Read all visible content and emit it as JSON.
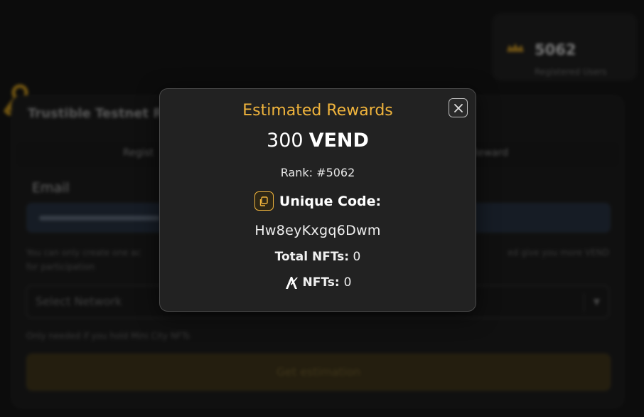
{
  "background": {
    "stats": {
      "value": "5062",
      "label": "Registered Users"
    },
    "panel_title": "Trustible Testnet R",
    "tabs": [
      "Regist",
      "Reward"
    ],
    "email_label": "Email",
    "email_hint_left": "You can only create one ac",
    "email_hint_right": "ed give you more VEND",
    "email_hint_line2": "for participation",
    "network_placeholder": "Select Network",
    "network_hint": "Only needed if you hold Mini City NFTs",
    "button_label": "Get estimation"
  },
  "modal": {
    "title": "Estimated Rewards",
    "reward_amount": "300",
    "reward_unit": "VEND",
    "rank": "Rank: #5062",
    "code_heading": "Unique Code:",
    "code_value": "Hw8eyKxgq6Dwm",
    "total_nfts_label": "Total NFTs:",
    "total_nfts_value": "0",
    "algo_nfts_label": "NFTs:",
    "algo_nfts_value": "0"
  },
  "colors": {
    "accent": "#f0b43c",
    "modal_bg": "#222222",
    "page_bg": "#161616"
  },
  "icons": {
    "close": "close-icon",
    "copy": "copy-icon",
    "algorand": "algorand-icon",
    "crown": "crown-icon",
    "key": "key-icon"
  }
}
